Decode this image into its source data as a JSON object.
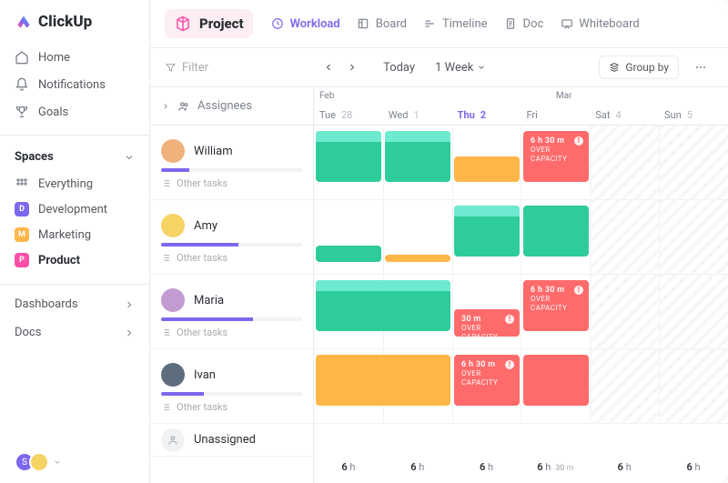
{
  "brand": "ClickUp",
  "sidebar": {
    "nav": [
      {
        "icon": "home-icon",
        "label": "Home"
      },
      {
        "icon": "bell-icon",
        "label": "Notifications"
      },
      {
        "icon": "trophy-icon",
        "label": "Goals"
      }
    ],
    "spaces_header": "Spaces",
    "everything": {
      "label": "Everything"
    },
    "spaces": [
      {
        "key": "D",
        "label": "Development",
        "color": "#7b68ee"
      },
      {
        "key": "M",
        "label": "Marketing",
        "color": "#ffb648"
      },
      {
        "key": "P",
        "label": "Product",
        "color": "#ff4fa7",
        "active": true
      }
    ],
    "collapsed": [
      {
        "label": "Dashboards"
      },
      {
        "label": "Docs"
      }
    ]
  },
  "topbar": {
    "project_title": "Project",
    "views": [
      {
        "icon": "workload-icon",
        "label": "Workload",
        "active": true
      },
      {
        "icon": "board-icon",
        "label": "Board"
      },
      {
        "icon": "timeline-icon",
        "label": "Timeline"
      },
      {
        "icon": "doc-icon",
        "label": "Doc"
      },
      {
        "icon": "whiteboard-icon",
        "label": "Whiteboard"
      }
    ]
  },
  "toolbar": {
    "filter_label": "Filter",
    "today_label": "Today",
    "range_label": "1 Week",
    "group_by_label": "Group by"
  },
  "workload": {
    "assignees_header": "Assignees",
    "other_tasks_label": "Other tasks",
    "months": [
      "Feb",
      "Mar"
    ],
    "days": [
      {
        "name": "Tue",
        "num": "28"
      },
      {
        "name": "Wed",
        "num": "1"
      },
      {
        "name": "Thu",
        "num": "2",
        "today": true
      },
      {
        "name": "Fri",
        "num": ""
      },
      {
        "name": "Sat",
        "num": "4"
      },
      {
        "name": "Sun",
        "num": "5"
      }
    ],
    "over_capacity_label": "OVER CAPACITY",
    "rows": [
      {
        "name": "William",
        "capacity_pct": 20,
        "avatar": "#f0b27a",
        "blocks": [
          {
            "type": "green-top",
            "start": 0,
            "span": 1
          },
          {
            "type": "green-top",
            "start": 1,
            "span": 1
          },
          {
            "type": "orange",
            "start": 2,
            "span": 1,
            "half": true
          },
          {
            "type": "red",
            "start": 3,
            "span": 1,
            "title": "6 h 30 m",
            "sub": "OVER CAPACITY"
          }
        ]
      },
      {
        "name": "Amy",
        "capacity_pct": 55,
        "avatar": "#f6d365",
        "blocks": [
          {
            "type": "green-top",
            "start": 2,
            "span": 1
          },
          {
            "type": "green",
            "start": 3,
            "span": 1
          },
          {
            "type": "green",
            "start": 0,
            "span": 1,
            "low": true,
            "h": 18
          },
          {
            "type": "orange",
            "start": 1,
            "span": 1,
            "low": true,
            "h": 8
          }
        ]
      },
      {
        "name": "Maria",
        "capacity_pct": 65,
        "avatar": "#c39bd3",
        "blocks": [
          {
            "type": "green-top",
            "start": 0,
            "span": 2
          },
          {
            "type": "red",
            "start": 2,
            "span": 1,
            "title": "30 m",
            "sub": "OVER CAPACITY",
            "low": true,
            "h": 30
          },
          {
            "type": "red",
            "start": 3,
            "span": 1,
            "title": "6 h 30 m",
            "sub": "OVER CAPACITY"
          }
        ]
      },
      {
        "name": "Ivan",
        "capacity_pct": 30,
        "avatar": "#5d6d7e",
        "blocks": [
          {
            "type": "orange",
            "start": 0,
            "span": 2
          },
          {
            "type": "red",
            "start": 2,
            "span": 1,
            "title": "6 h 30 m",
            "sub": "OVER CAPACITY"
          },
          {
            "type": "red",
            "start": 3,
            "span": 1,
            "title": "",
            "sub": ""
          }
        ]
      }
    ],
    "unassigned_label": "Unassigned",
    "summary": [
      {
        "h": "6",
        "m": ""
      },
      {
        "h": "6",
        "m": ""
      },
      {
        "h": "6",
        "m": ""
      },
      {
        "h": "6",
        "m": "30"
      },
      {
        "h": "6",
        "m": ""
      },
      {
        "h": "6",
        "m": ""
      }
    ]
  },
  "colors": {
    "purple": "#7b68ee",
    "green": "#2ecc9b",
    "orange": "#ffb648",
    "red": "#ff6b6b",
    "pink": "#ff4fa7"
  }
}
